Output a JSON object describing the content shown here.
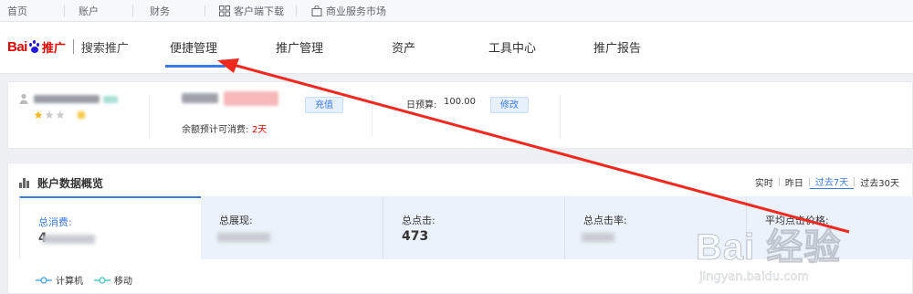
{
  "topbar": {
    "home": "首页",
    "account": "账户",
    "finance": "财务",
    "client_download": "客户端下载",
    "service_market": "商业服务市场"
  },
  "header": {
    "logo_bai": "Bai",
    "logo_du": "du",
    "logo_tuiguang": "推广",
    "logo_sub": "搜索推广",
    "nav": [
      "便捷管理",
      "推广管理",
      "资产",
      "工具中心",
      "推广报告"
    ]
  },
  "account_card": {
    "recharge_label": "充值",
    "balance_days_label": "余额预计可消费:",
    "balance_days_value": "2天",
    "daily_budget_label": "日预算:",
    "daily_budget_value": "100.00",
    "modify_label": "修改"
  },
  "overview": {
    "title": "账户数据概览",
    "ranges": [
      "实时",
      "昨日",
      "过去7天",
      "过去30天"
    ],
    "active_range": "过去7天",
    "metrics": [
      {
        "label": "总消费:",
        "value": "4"
      },
      {
        "label": "总展现:",
        "value": ""
      },
      {
        "label": "总点击:",
        "value": "473"
      },
      {
        "label": "总点击率:",
        "value": ""
      },
      {
        "label": "平均点击价格:",
        "value": ""
      }
    ],
    "legend": [
      "计算机",
      "移动"
    ]
  },
  "watermark": {
    "brand": "Bai  经验",
    "url": "jingyan.baidu.com"
  },
  "colors": {
    "accent": "#3c7ae6",
    "brand_red": "#e10602",
    "brand_blue": "#2319dc",
    "annotation_arrow": "#f0281e"
  }
}
